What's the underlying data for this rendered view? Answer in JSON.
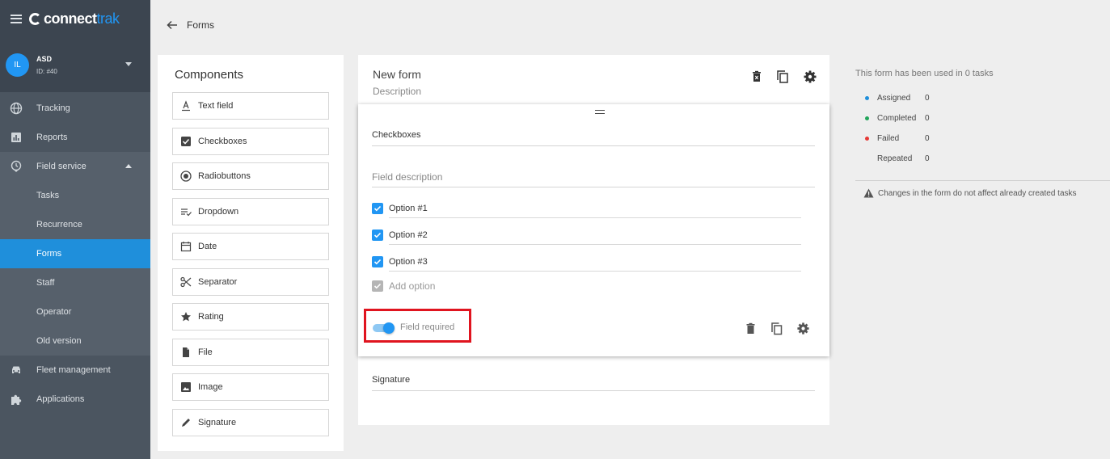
{
  "app": {
    "logo_primary": "connect",
    "logo_secondary": "trak"
  },
  "user": {
    "initials": "IL",
    "name": "ASD",
    "id_label": "ID: #40"
  },
  "nav": {
    "tracking": "Tracking",
    "reports": "Reports",
    "field_service": "Field service",
    "tasks": "Tasks",
    "recurrence": "Recurrence",
    "forms": "Forms",
    "staff": "Staff",
    "operator": "Operator",
    "old_version": "Old version",
    "fleet_management": "Fleet management",
    "applications": "Applications"
  },
  "page": {
    "title": "Forms"
  },
  "components": {
    "title": "Components",
    "items": [
      "Text field",
      "Checkboxes",
      "Radiobuttons",
      "Dropdown",
      "Date",
      "Separator",
      "Rating",
      "File",
      "Image",
      "Signature"
    ]
  },
  "form": {
    "title": "New form",
    "description": "Description",
    "field_title": "Checkboxes",
    "field_description": "Field description",
    "options": [
      "Option #1",
      "Option #2",
      "Option #3"
    ],
    "add_option": "Add option",
    "field_required": "Field required",
    "next_field": "Signature"
  },
  "stats": {
    "title": "This form has been used in 0 tasks",
    "assigned_label": "Assigned",
    "assigned_value": "0",
    "completed_label": "Completed",
    "completed_value": "0",
    "failed_label": "Failed",
    "failed_value": "0",
    "repeated_label": "Repeated",
    "repeated_value": "0",
    "warning": "Changes in the form do not affect already created tasks"
  },
  "colors": {
    "accent": "#2196f3",
    "assigned": "#1f8fdb",
    "completed": "#22a55a",
    "failed": "#e53935",
    "highlight": "#e0141f"
  }
}
